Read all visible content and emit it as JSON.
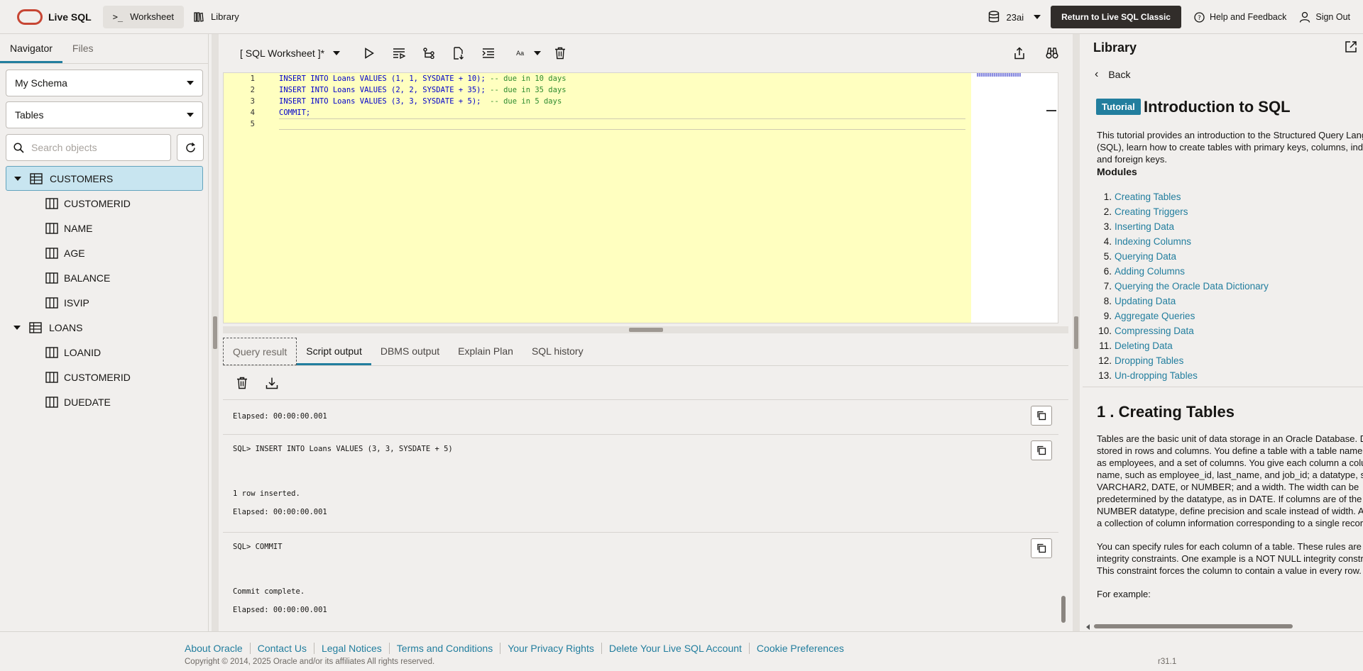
{
  "app": {
    "brand": "Live SQL",
    "nav": [
      {
        "label": "Worksheet",
        "icon": "terminal-icon",
        "active": true
      },
      {
        "label": "Library",
        "icon": "library-icon",
        "active": false
      }
    ],
    "database": "23ai",
    "classic_button": "Return to Live SQL Classic",
    "help": "Help and Feedback",
    "signout": "Sign Out"
  },
  "navigator": {
    "tabs": [
      "Navigator",
      "Files"
    ],
    "active_tab": "Navigator",
    "schema": "My Schema",
    "object_type": "Tables",
    "search_placeholder": "Search objects",
    "tables": [
      {
        "name": "CUSTOMERS",
        "selected": true,
        "columns": [
          "CUSTOMERID",
          "NAME",
          "AGE",
          "BALANCE",
          "ISVIP"
        ]
      },
      {
        "name": "LOANS",
        "selected": false,
        "columns": [
          "LOANID",
          "CUSTOMERID",
          "DUEDATE"
        ]
      }
    ]
  },
  "worksheet": {
    "title": "[ SQL Worksheet ]*",
    "font_button": "Aa",
    "lines": [
      {
        "num": "1",
        "code": "INSERT INTO Loans VALUES (1, 1, SYSDATE + 10); ",
        "comment": "-- due in 10 days"
      },
      {
        "num": "2",
        "code": "INSERT INTO Loans VALUES (2, 2, SYSDATE + 35); ",
        "comment": "-- due in 35 days"
      },
      {
        "num": "3",
        "code": "INSERT INTO Loans VALUES (3, 3, SYSDATE + 5);  ",
        "comment": "-- due in 5 days"
      },
      {
        "num": "4",
        "code": "COMMIT;",
        "comment": ""
      },
      {
        "num": "5",
        "code": "",
        "comment": ""
      }
    ]
  },
  "output": {
    "tabs": [
      "Query result",
      "Script output",
      "DBMS output",
      "Explain Plan",
      "SQL history"
    ],
    "active_tab": "Script output",
    "blocks": [
      {
        "lines": [
          "Elapsed: 00:00:00.001"
        ]
      },
      {
        "lines": [
          "SQL> INSERT INTO Loans VALUES (3, 3, SYSDATE + 5)",
          "1 row inserted.",
          "Elapsed: 00:00:00.001"
        ]
      },
      {
        "lines": [
          "SQL> COMMIT",
          "Commit complete.",
          "Elapsed: 00:00:00.001"
        ]
      }
    ]
  },
  "library": {
    "title": "Library",
    "back": "Back",
    "badge": "Tutorial",
    "heading": "Introduction to SQL",
    "intro": "This tutorial provides an introduction to the Structured Query Language (SQL), learn how to create tables with primary keys, columns, indexes, and foreign keys.",
    "modules_label": "Modules",
    "modules": [
      "Creating Tables",
      "Creating Triggers",
      "Inserting Data",
      "Indexing Columns",
      "Querying Data",
      "Adding Columns",
      "Querying the Oracle Data Dictionary",
      "Updating Data",
      "Aggregate Queries",
      "Compressing Data",
      "Deleting Data",
      "Dropping Tables",
      "Un-dropping Tables"
    ],
    "section_heading": "1 . Creating Tables",
    "section_p1": "Tables are the basic unit of data storage in an Oracle Database. Data is stored in rows and columns. You define a table with a table name, such as employees, and a set of columns. You give each column a column name, such as employee_id, last_name, and job_id; a datatype, such as VARCHAR2, DATE, or NUMBER; and a width. The width can be predetermined by the datatype, as in DATE. If columns are of the NUMBER datatype, define precision and scale instead of width. A row is a collection of column information corresponding to a single record.",
    "section_p2": "You can specify rules for each column of a table. These rules are called integrity constraints. One example is a NOT NULL integrity constraint. This constraint forces the column to contain a value in every row.",
    "example_label": "For example:"
  },
  "footer": {
    "links": [
      "About Oracle",
      "Contact Us",
      "Legal Notices",
      "Terms and Conditions",
      "Your Privacy Rights",
      "Delete Your Live SQL Account",
      "Cookie Preferences"
    ],
    "copyright": "Copyright © 2014, 2025 Oracle and/or its affiliates All rights reserved.",
    "version": "r31.1"
  }
}
